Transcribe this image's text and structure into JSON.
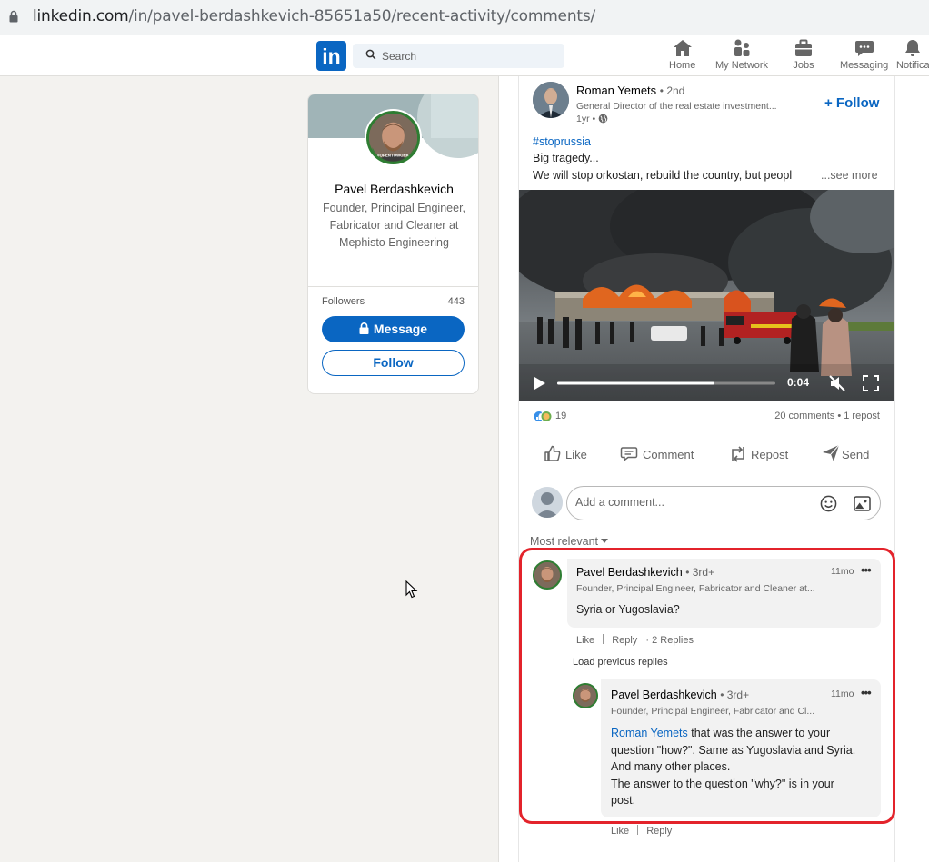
{
  "browser": {
    "url_host": "linkedin.com",
    "url_path": "/in/pavel-berdashkevich-85651a50/recent-activity/comments/"
  },
  "nav": {
    "logo": "in",
    "search_placeholder": "Search",
    "items": [
      {
        "label": "Home",
        "icon": "home-icon"
      },
      {
        "label": "My Network",
        "icon": "network-icon"
      },
      {
        "label": "Jobs",
        "icon": "briefcase-icon"
      },
      {
        "label": "Messaging",
        "icon": "chat-icon"
      },
      {
        "label": "Notifica",
        "icon": "bell-icon"
      }
    ]
  },
  "profile": {
    "name": "Pavel Berdashkevich",
    "headline": "Founder, Principal Engineer, Fabricator and Cleaner at Mephisto Engineering",
    "badge": "#OPENTOWORK",
    "followers_label": "Followers",
    "followers_count": "443",
    "message_label": "Message",
    "follow_label": "Follow"
  },
  "post": {
    "author": "Roman Yemets",
    "degree": "• 2nd",
    "headline": "General Director of the real estate investment...",
    "time": "1yr •",
    "follow_label": "+ Follow",
    "hashtag": "#stoprussia",
    "text_line1": "Big tragedy...",
    "text_line2": "We will stop orkostan, rebuild the country, but peopl",
    "see_more": "...see more",
    "video_time": "0:04",
    "video_progress": 0.72,
    "reaction_count": "19",
    "comments_reposts": "20 comments • 1 repost",
    "actions": {
      "like": "Like",
      "comment": "Comment",
      "repost": "Repost",
      "send": "Send"
    },
    "comment_placeholder": "Add a comment...",
    "sort_label": "Most relevant"
  },
  "comments": [
    {
      "author": "Pavel Berdashkevich",
      "degree": "• 3rd+",
      "headline": "Founder, Principal Engineer, Fabricator and Cleaner at...",
      "time": "11mo",
      "text": "Syria or Yugoslavia?",
      "like": "Like",
      "reply": "Reply",
      "replies": "· 2 Replies"
    }
  ],
  "load_previous": "Load previous replies",
  "reply": {
    "author": "Pavel Berdashkevich",
    "degree": "• 3rd+",
    "headline": "Founder, Principal Engineer, Fabricator and Cl...",
    "time": "11mo",
    "mention": "Roman Yemets",
    "text_l1": " that was the answer to your",
    "text_l2": "question \"how?\". Same as Yugoslavia and Syria.",
    "text_l3": "And many other places.",
    "text_l4": "The answer to the question \"why?\" is in your",
    "text_l5": "post.",
    "like": "Like",
    "reply": "Reply"
  },
  "colors": {
    "brand": "#0a66c2",
    "highlight": "#e3232b",
    "opentowork": "#2e7d32"
  }
}
